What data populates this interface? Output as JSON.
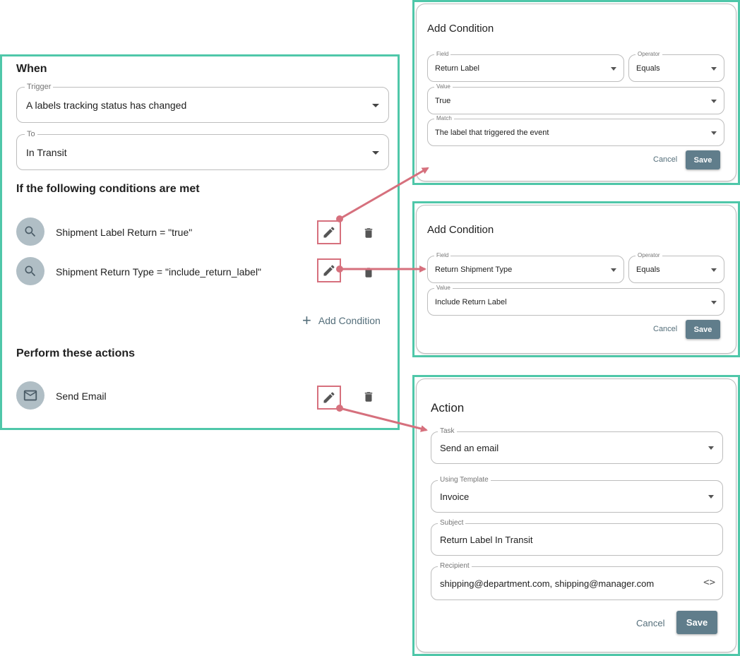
{
  "rule": {
    "when_heading": "When",
    "trigger": {
      "label": "Trigger",
      "value": "A labels tracking status has changed"
    },
    "to": {
      "label": "To",
      "value": "In Transit"
    },
    "conditions_heading": "If the following conditions are met",
    "conditions": [
      {
        "text": "Shipment Label Return = \"true\"",
        "icon": "search-icon"
      },
      {
        "text": "Shipment Return Type = \"include_return_label\"",
        "icon": "search-icon"
      }
    ],
    "add_condition_label": "Add Condition",
    "actions_heading": "Perform these actions",
    "actions": [
      {
        "text": "Send Email",
        "icon": "mail-icon"
      }
    ]
  },
  "condition_dialog_1": {
    "title": "Add Condition",
    "field": {
      "label": "Field",
      "value": "Return Label"
    },
    "operator": {
      "label": "Operator",
      "value": "Equals"
    },
    "value": {
      "label": "Value",
      "value": "True"
    },
    "match": {
      "label": "Match",
      "value": "The label that triggered the event"
    },
    "cancel_label": "Cancel",
    "save_label": "Save"
  },
  "condition_dialog_2": {
    "title": "Add Condition",
    "field": {
      "label": "Field",
      "value": "Return Shipment Type"
    },
    "operator": {
      "label": "Operator",
      "value": "Equals"
    },
    "value": {
      "label": "Value",
      "value": "Include Return Label"
    },
    "cancel_label": "Cancel",
    "save_label": "Save"
  },
  "action_dialog": {
    "title": "Action",
    "task": {
      "label": "Task",
      "value": "Send an email"
    },
    "template": {
      "label": "Using Template",
      "value": "Invoice"
    },
    "subject": {
      "label": "Subject",
      "value": "Return Label In Transit"
    },
    "recipient": {
      "label": "Recipient",
      "value": "shipping@department.com, shipping@manager.com"
    },
    "cancel_label": "Cancel",
    "save_label": "Save"
  },
  "colors": {
    "panel_border": "#4fc7a9",
    "highlight": "#d6707d",
    "save_button": "#607d8b",
    "icon_circle": "#b0bec5"
  }
}
